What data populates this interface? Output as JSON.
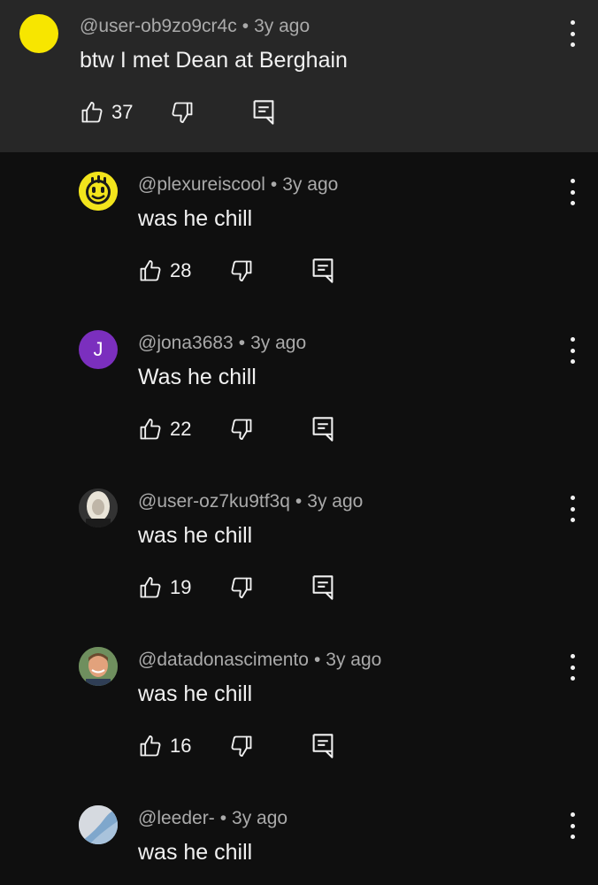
{
  "separator": "•",
  "comments": [
    {
      "handle": "@user-ob9zo9cr4c",
      "time": "3y ago",
      "text": "btw I met Dean at Berghain",
      "likes": "37",
      "avatar": {
        "type": "solid",
        "color": "#f7e600"
      }
    },
    {
      "handle": "@plexureiscool",
      "time": "3y ago",
      "text": "was he chill",
      "likes": "28",
      "avatar": {
        "type": "melting-smiley",
        "color": "#f2e41c"
      }
    },
    {
      "handle": "@jona3683",
      "time": "3y ago",
      "text": "Was he chill",
      "likes": "22",
      "avatar": {
        "type": "letter",
        "letter": "J",
        "color": "#7b2fbe"
      }
    },
    {
      "handle": "@user-oz7ku9tf3q",
      "time": "3y ago",
      "text": "was he chill",
      "likes": "19",
      "avatar": {
        "type": "photo-portrait-blonde"
      }
    },
    {
      "handle": "@datadonascimento",
      "time": "3y ago",
      "text": "was he chill",
      "likes": "16",
      "avatar": {
        "type": "photo-portrait-man"
      }
    },
    {
      "handle": "@leeder-",
      "time": "3y ago",
      "text": "was he chill",
      "likes": "",
      "avatar": {
        "type": "photo-abstract-blue"
      }
    }
  ]
}
